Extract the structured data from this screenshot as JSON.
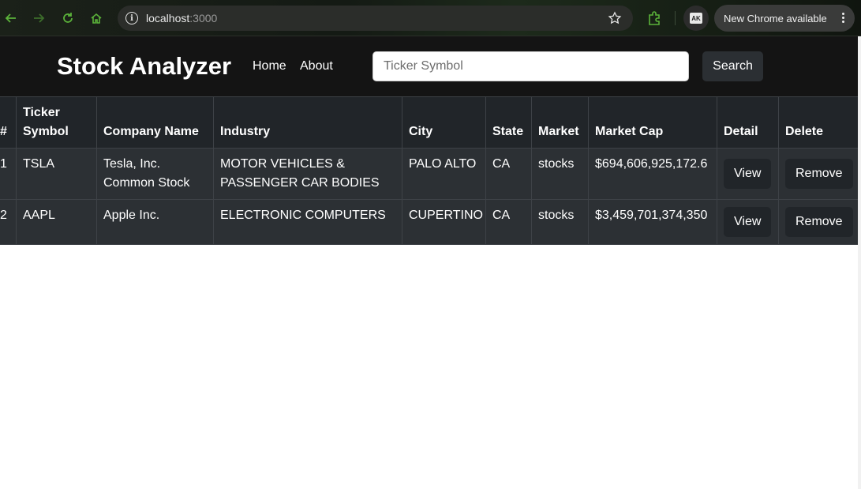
{
  "browser": {
    "url_host": "localhost",
    "url_port": ":3000",
    "update_label": "New Chrome available",
    "profile_label": "AK"
  },
  "app": {
    "brand": "Stock Analyzer",
    "nav": {
      "home": "Home",
      "about": "About"
    },
    "search": {
      "placeholder": "Ticker Symbol",
      "value": "",
      "button": "Search"
    }
  },
  "table": {
    "headers": {
      "num": "#",
      "ticker": "Ticker Symbol",
      "company": "Company Name",
      "industry": "Industry",
      "city": "City",
      "state": "State",
      "market": "Market",
      "market_cap": "Market Cap",
      "detail": "Detail",
      "delete": "Delete"
    },
    "rows": [
      {
        "num": "1",
        "ticker": "TSLA",
        "company": "Tesla, Inc. Common Stock",
        "industry": "MOTOR VEHICLES & PASSENGER CAR BODIES",
        "city": "PALO ALTO",
        "state": "CA",
        "market": "stocks",
        "market_cap": "$694,606,925,172.6",
        "view": "View",
        "remove": "Remove"
      },
      {
        "num": "2",
        "ticker": "AAPL",
        "company": "Apple Inc.",
        "industry": "ELECTRONIC COMPUTERS",
        "city": "CUPERTINO",
        "state": "CA",
        "market": "stocks",
        "market_cap": "$3,459,701,374,350",
        "view": "View",
        "remove": "Remove"
      }
    ]
  },
  "colors": {
    "navbar_bg": "#141414",
    "table_head_bg": "#212529",
    "table_row_bg": "#2c3034",
    "accent_green": "#5bb33a"
  }
}
